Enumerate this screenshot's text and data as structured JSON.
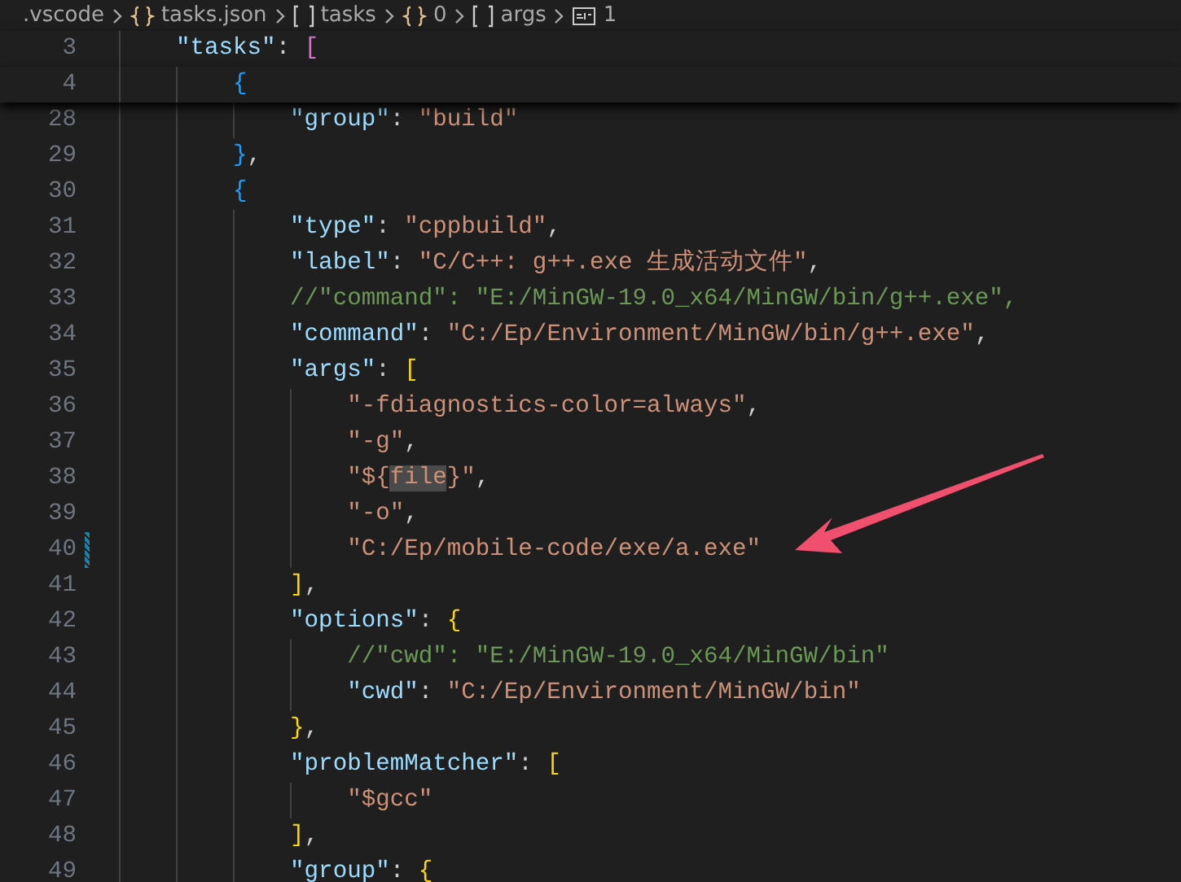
{
  "breadcrumbs": [
    {
      "kind": "folder",
      "label": ".vscode"
    },
    {
      "kind": "object",
      "label": "tasks.json"
    },
    {
      "kind": "array",
      "label": "tasks"
    },
    {
      "kind": "object",
      "label": "0"
    },
    {
      "kind": "array",
      "label": "args"
    },
    {
      "kind": "string",
      "label": "1"
    }
  ],
  "lines": [
    {
      "number": "3",
      "kind": "sticky",
      "modified": false,
      "tokens": [
        {
          "kind": "key",
          "text": "\"tasks\""
        },
        {
          "kind": "punct",
          "text": ": "
        },
        {
          "kind": "bracket2",
          "text": "["
        }
      ],
      "children": [
        {
          "number": "4",
          "kind": "sticky",
          "modified": false,
          "tokens": [
            {
              "kind": "bracket3",
              "text": "{"
            }
          ],
          "children": [
            {
              "number": "28",
              "kind": "line",
              "modified": false,
              "tokens": [
                {
                  "kind": "key",
                  "text": "\"group\""
                },
                {
                  "kind": "punct",
                  "text": ": "
                },
                {
                  "kind": "string",
                  "text": "\"build\""
                }
              ]
            }
          ]
        },
        {
          "number": "29",
          "kind": "line",
          "modified": false,
          "tokens": [
            {
              "kind": "bracket3",
              "text": "}"
            },
            {
              "kind": "punct",
              "text": ","
            }
          ]
        },
        {
          "number": "30",
          "kind": "line",
          "modified": false,
          "tokens": [
            {
              "kind": "bracket3",
              "text": "{"
            }
          ],
          "children": [
            {
              "number": "31",
              "kind": "line",
              "modified": false,
              "tokens": [
                {
                  "kind": "key",
                  "text": "\"type\""
                },
                {
                  "kind": "punct",
                  "text": ": "
                },
                {
                  "kind": "string",
                  "text": "\"cppbuild\""
                },
                {
                  "kind": "punct",
                  "text": ","
                }
              ]
            },
            {
              "number": "32",
              "kind": "line",
              "modified": false,
              "tokens": [
                {
                  "kind": "key",
                  "text": "\"label\""
                },
                {
                  "kind": "punct",
                  "text": ": "
                },
                {
                  "kind": "string",
                  "text": "\"C/C++: g++.exe 生成活动文件\""
                },
                {
                  "kind": "punct",
                  "text": ","
                }
              ]
            },
            {
              "number": "33",
              "kind": "line",
              "modified": false,
              "tokens": [
                {
                  "kind": "comment",
                  "text": "//\"command\": \"E:/MinGW-19.0_x64/MinGW/bin/g++.exe\","
                }
              ]
            },
            {
              "number": "34",
              "kind": "line",
              "modified": false,
              "tokens": [
                {
                  "kind": "key",
                  "text": "\"command\""
                },
                {
                  "kind": "punct",
                  "text": ": "
                },
                {
                  "kind": "string",
                  "text": "\"C:/Ep/Environment/MinGW/bin/g++.exe\""
                },
                {
                  "kind": "punct",
                  "text": ","
                }
              ]
            },
            {
              "number": "35",
              "kind": "line",
              "modified": false,
              "tokens": [
                {
                  "kind": "key",
                  "text": "\"args\""
                },
                {
                  "kind": "punct",
                  "text": ": "
                },
                {
                  "kind": "bracket1",
                  "text": "["
                }
              ],
              "children": [
                {
                  "number": "36",
                  "kind": "line",
                  "modified": false,
                  "tokens": [
                    {
                      "kind": "string",
                      "text": "\"-fdiagnostics-color=always\""
                    },
                    {
                      "kind": "punct",
                      "text": ","
                    }
                  ]
                },
                {
                  "number": "37",
                  "kind": "line",
                  "modified": false,
                  "tokens": [
                    {
                      "kind": "string",
                      "text": "\"-g\""
                    },
                    {
                      "kind": "punct",
                      "text": ","
                    }
                  ]
                },
                {
                  "number": "38",
                  "kind": "line",
                  "modified": false,
                  "tokens": [
                    {
                      "kind": "string",
                      "text": "\"${"
                    },
                    {
                      "kind": "match",
                      "text": "file"
                    },
                    {
                      "kind": "string",
                      "text": "}\""
                    },
                    {
                      "kind": "punct",
                      "text": ","
                    }
                  ]
                },
                {
                  "number": "39",
                  "kind": "line",
                  "modified": false,
                  "tokens": [
                    {
                      "kind": "string",
                      "text": "\"-o\""
                    },
                    {
                      "kind": "punct",
                      "text": ","
                    }
                  ]
                },
                {
                  "number": "40",
                  "kind": "line",
                  "modified": true,
                  "tokens": [
                    {
                      "kind": "string",
                      "text": "\"C:/Ep/mobile-code/exe/a.exe\""
                    }
                  ]
                }
              ]
            },
            {
              "number": "41",
              "kind": "line",
              "modified": false,
              "tokens": [
                {
                  "kind": "bracket1",
                  "text": "]"
                },
                {
                  "kind": "punct",
                  "text": ","
                }
              ]
            },
            {
              "number": "42",
              "kind": "line",
              "modified": false,
              "tokens": [
                {
                  "kind": "key",
                  "text": "\"options\""
                },
                {
                  "kind": "punct",
                  "text": ": "
                },
                {
                  "kind": "bracket1",
                  "text": "{"
                }
              ],
              "children": [
                {
                  "number": "43",
                  "kind": "line",
                  "modified": false,
                  "tokens": [
                    {
                      "kind": "comment",
                      "text": "//\"cwd\": \"E:/MinGW-19.0_x64/MinGW/bin\""
                    }
                  ]
                },
                {
                  "number": "44",
                  "kind": "line",
                  "modified": false,
                  "tokens": [
                    {
                      "kind": "key",
                      "text": "\"cwd\""
                    },
                    {
                      "kind": "punct",
                      "text": ": "
                    },
                    {
                      "kind": "string",
                      "text": "\"C:/Ep/Environment/MinGW/bin\""
                    }
                  ]
                }
              ]
            },
            {
              "number": "45",
              "kind": "line",
              "modified": false,
              "tokens": [
                {
                  "kind": "bracket1",
                  "text": "}"
                },
                {
                  "kind": "punct",
                  "text": ","
                }
              ]
            },
            {
              "number": "46",
              "kind": "line",
              "modified": false,
              "tokens": [
                {
                  "kind": "key",
                  "text": "\"problemMatcher\""
                },
                {
                  "kind": "punct",
                  "text": ": "
                },
                {
                  "kind": "bracket1",
                  "text": "["
                }
              ],
              "children": [
                {
                  "number": "47",
                  "kind": "line",
                  "modified": false,
                  "tokens": [
                    {
                      "kind": "string",
                      "text": "\"$gcc\""
                    }
                  ]
                }
              ]
            },
            {
              "number": "48",
              "kind": "line",
              "modified": false,
              "tokens": [
                {
                  "kind": "bracket1",
                  "text": "]"
                },
                {
                  "kind": "punct",
                  "text": ","
                }
              ]
            },
            {
              "number": "49",
              "kind": "line",
              "modified": false,
              "tokens": [
                {
                  "kind": "key",
                  "text": "\"group\""
                },
                {
                  "kind": "punct",
                  "text": ": "
                },
                {
                  "kind": "bracket1",
                  "text": "{"
                }
              ]
            }
          ]
        }
      ]
    }
  ]
}
